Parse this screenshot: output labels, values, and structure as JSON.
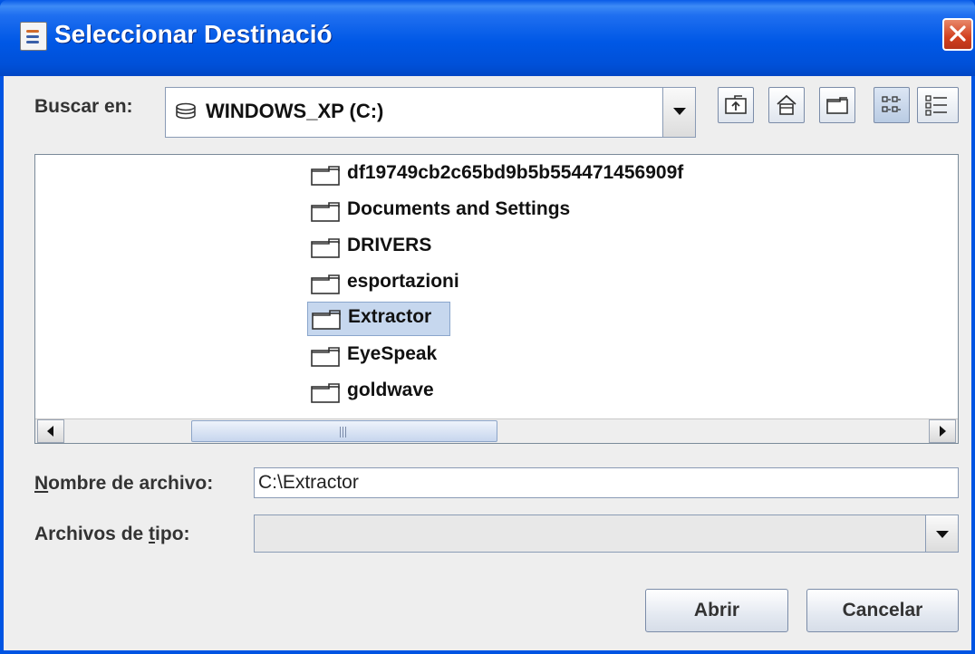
{
  "window": {
    "title": "Seleccionar Destinació",
    "title_icon": "java-cup-icon",
    "close_icon": "close-icon",
    "close_color": "#d2401f"
  },
  "look_in": {
    "label": "Buscar en:",
    "value": "WINDOWS_XP (C:)",
    "drive_icon": "hard-drive-icon"
  },
  "toolbar": [
    {
      "name": "up-one-level-button",
      "icon": "up-folder-icon"
    },
    {
      "name": "home-button",
      "icon": "home-icon"
    },
    {
      "name": "new-folder-button",
      "icon": "new-folder-icon"
    },
    {
      "name": "list-view-button",
      "icon": "list-view-icon",
      "active": true
    },
    {
      "name": "details-view-button",
      "icon": "details-view-icon"
    }
  ],
  "files": [
    {
      "name": "df19749cb2c65bd9b5b554471456909f",
      "selected": false
    },
    {
      "name": "Documents and Settings",
      "selected": false
    },
    {
      "name": "DRIVERS",
      "selected": false
    },
    {
      "name": "esportazioni",
      "selected": false
    },
    {
      "name": "Extractor",
      "selected": true
    },
    {
      "name": "EyeSpeak",
      "selected": false
    },
    {
      "name": "goldwave",
      "selected": false
    }
  ],
  "filename": {
    "label_mnemonic": "N",
    "label_rest": "ombre de archivo:",
    "value": "C:\\Extractor"
  },
  "filetype": {
    "label_pre": "Archivos de ",
    "label_mnemonic": "t",
    "label_post": "ipo:",
    "value": ""
  },
  "buttons": {
    "open": "Abrir",
    "cancel": "Cancelar"
  },
  "colors": {
    "titlebar": "#0058e6",
    "selection": "#c6d7ee"
  }
}
